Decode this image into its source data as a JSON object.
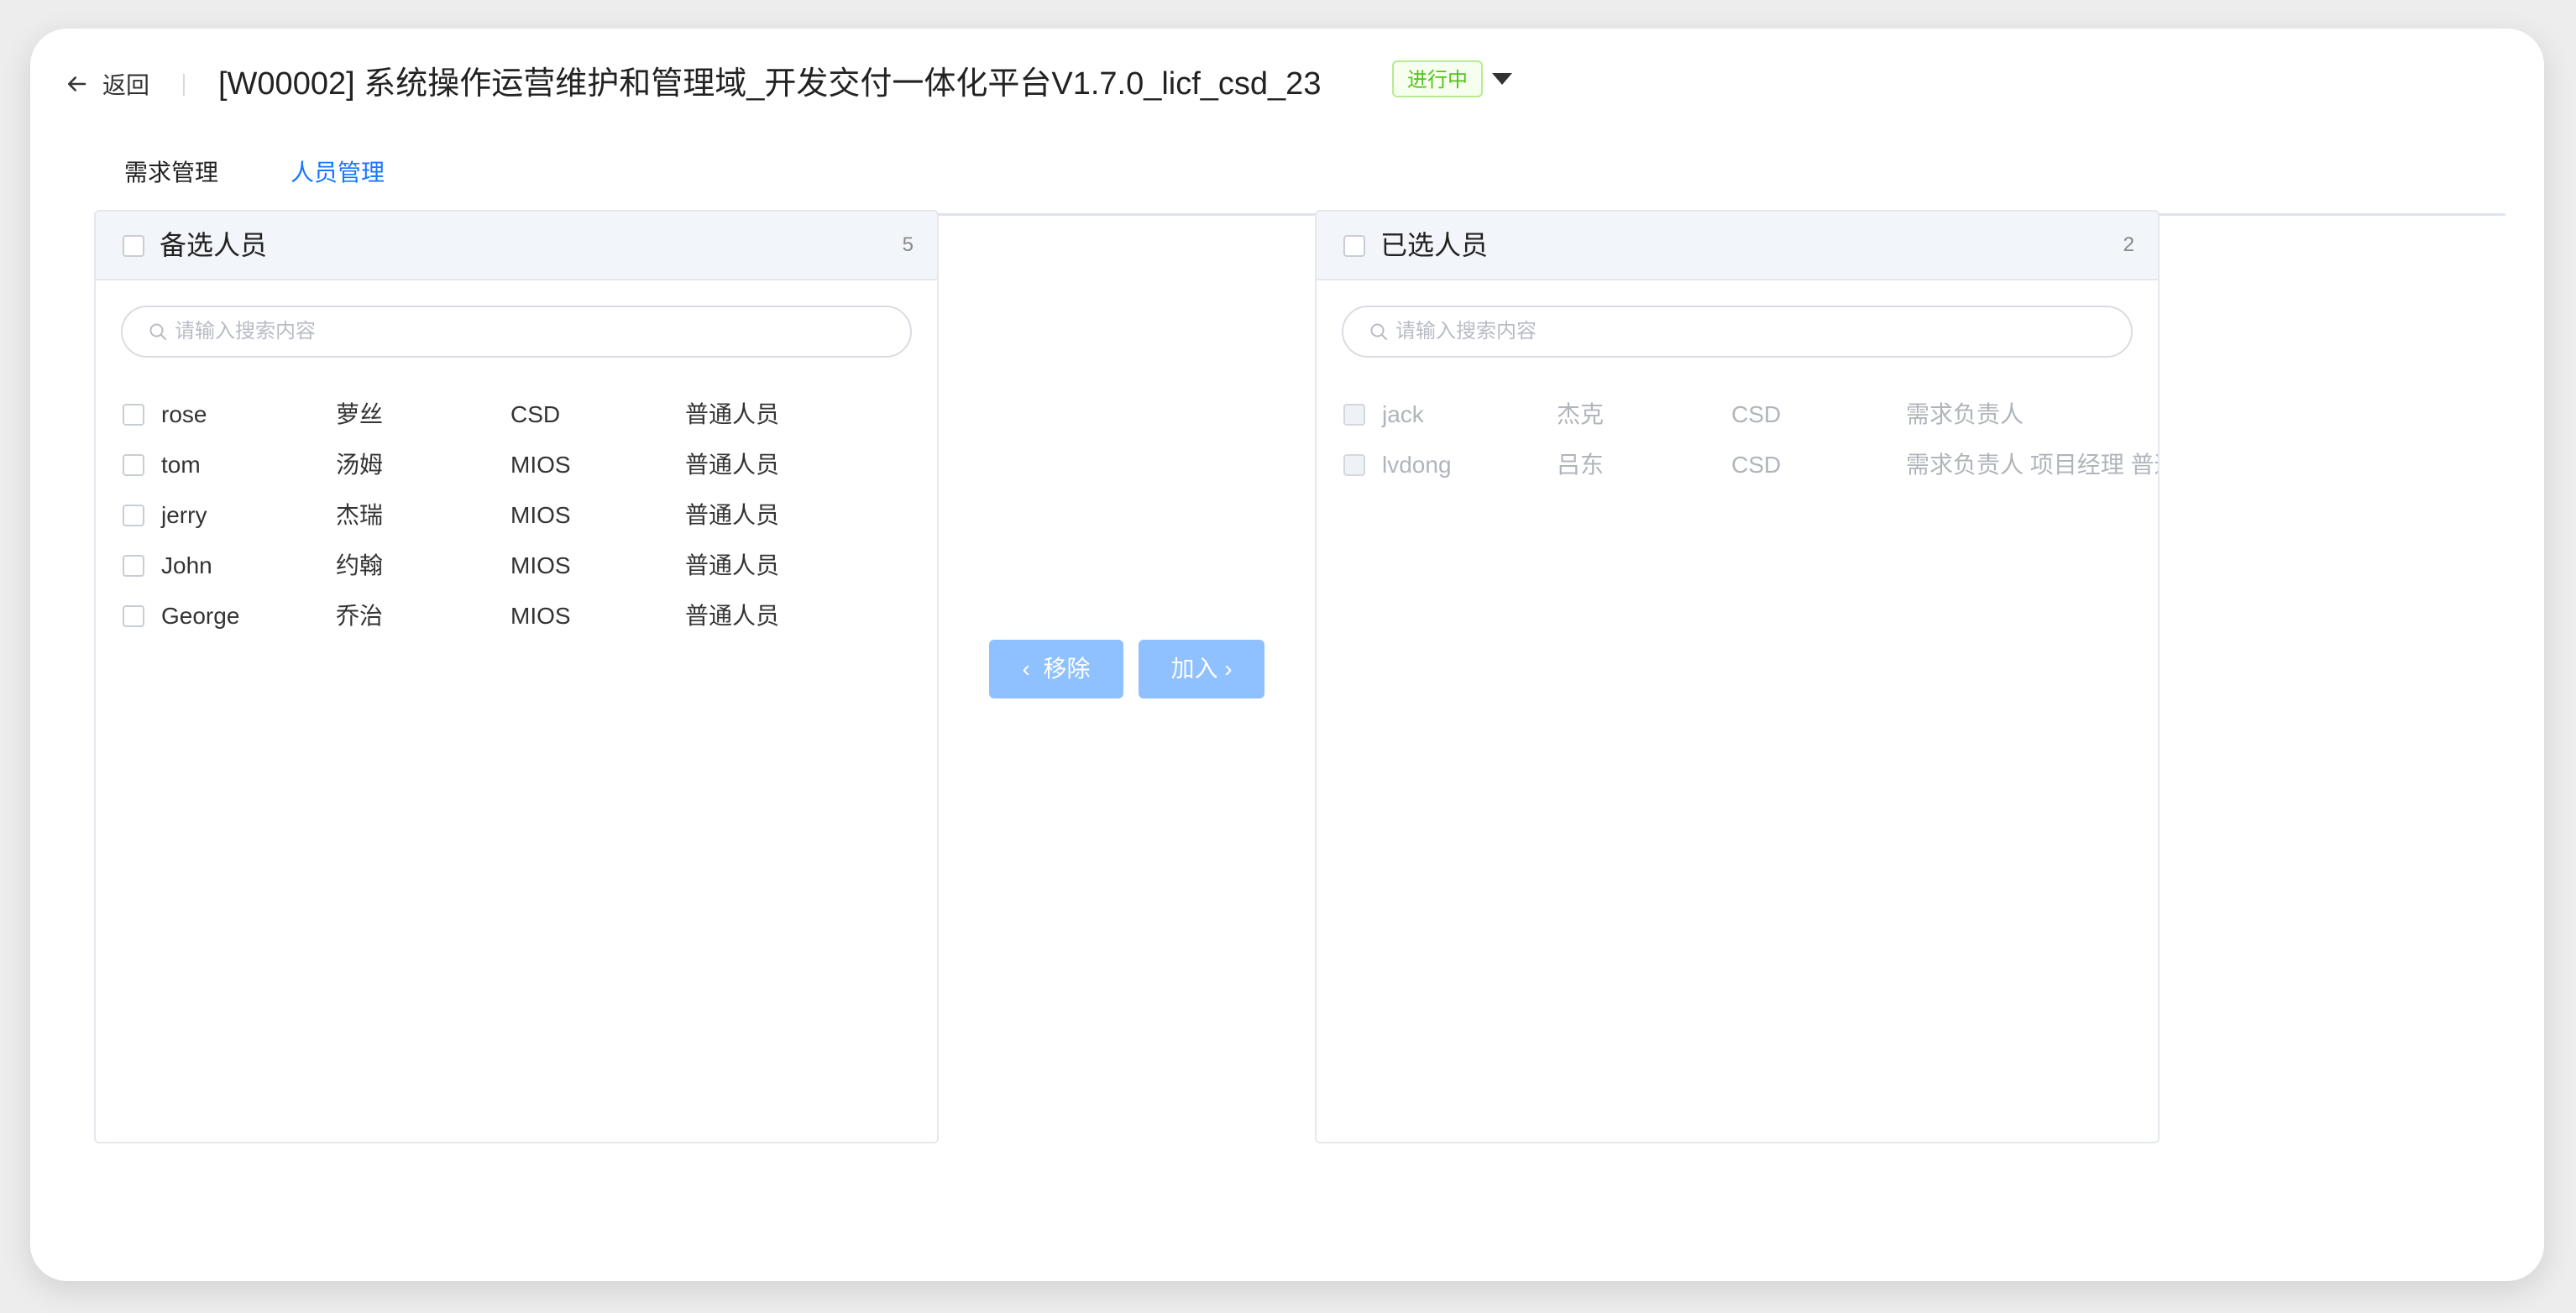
{
  "header": {
    "back_label": "返回",
    "title": "[W00002] 系统操作运营维护和管理域_开发交付一体化平台V1.7.0_licf_csd_23",
    "status": "进行中"
  },
  "tabs": [
    {
      "label": "需求管理",
      "active": false
    },
    {
      "label": "人员管理",
      "active": true
    }
  ],
  "left_panel": {
    "title": "备选人员",
    "count": "5",
    "search_placeholder": "请输入搜索内容",
    "rows": [
      {
        "account": "rose",
        "name": "萝丝",
        "org": "CSD",
        "role": "普通人员"
      },
      {
        "account": "tom",
        "name": "汤姆",
        "org": "MIOS",
        "role": "普通人员"
      },
      {
        "account": "jerry",
        "name": "杰瑞",
        "org": "MIOS",
        "role": "普通人员"
      },
      {
        "account": "John",
        "name": "约翰",
        "org": "MIOS",
        "role": "普通人员"
      },
      {
        "account": "George",
        "name": "乔治",
        "org": "MIOS",
        "role": "普通人员"
      }
    ]
  },
  "right_panel": {
    "title": "已选人员",
    "count": "2",
    "search_placeholder": "请输入搜索内容",
    "rows": [
      {
        "account": "jack",
        "name": "杰克",
        "org": "CSD",
        "role": "需求负责人"
      },
      {
        "account": "lvdong",
        "name": "吕东",
        "org": "CSD",
        "role": "需求负责人 项目经理 普通人员"
      }
    ]
  },
  "operations": {
    "remove_label": "移除",
    "add_label": "加入"
  },
  "colors": {
    "accent": "#1677ff",
    "button_disabled": "#8fc0ff",
    "status_green": "#52c41a"
  }
}
